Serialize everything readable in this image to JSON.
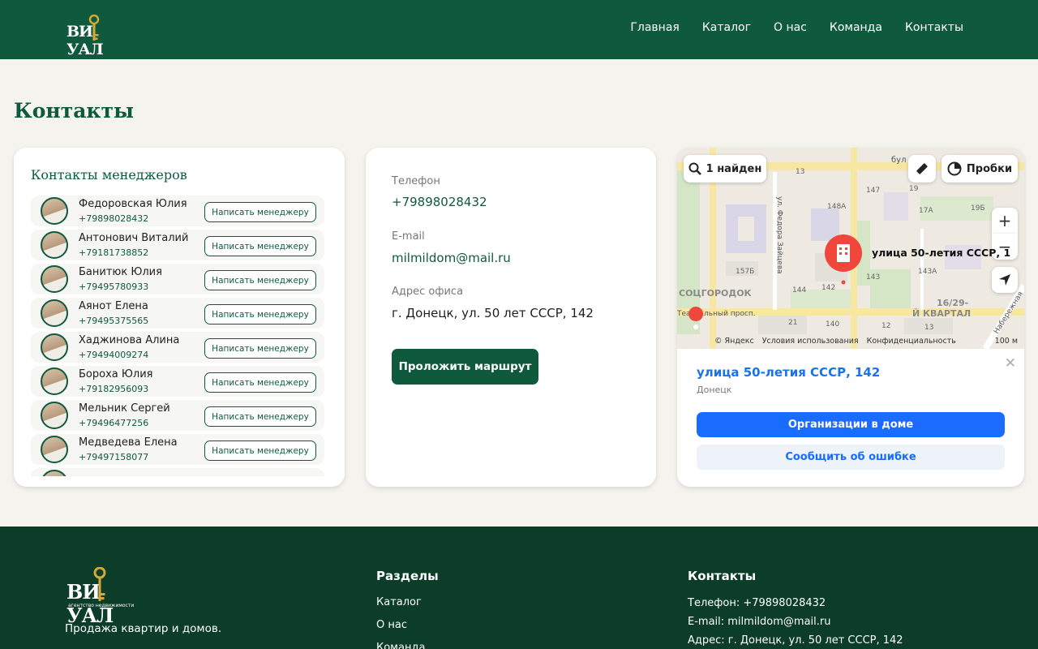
{
  "header": {
    "logo_text": "ВИ УАЛ",
    "nav": [
      "Главная",
      "Каталог",
      "О нас",
      "Команда",
      "Контакты"
    ]
  },
  "page_title": "Контакты",
  "managers": {
    "title": "Контакты менеджеров",
    "button_label": "Написать менеджеру",
    "items": [
      {
        "name": "Федоровская Юлия",
        "phone": "+79898028432"
      },
      {
        "name": "Антонович Виталий",
        "phone": "+79181738852"
      },
      {
        "name": "Банитюк Юлия",
        "phone": "+79495780933"
      },
      {
        "name": "Аянот Елена",
        "phone": "+79495375565"
      },
      {
        "name": "Хаджинова Алина",
        "phone": "+79494009274"
      },
      {
        "name": "Бороха Юлия",
        "phone": "+79182956093"
      },
      {
        "name": "Мельник Сергей",
        "phone": "+79496477256"
      },
      {
        "name": "Медведева Елена",
        "phone": "+79497158077"
      }
    ]
  },
  "contacts": {
    "phone_label": "Телефон",
    "phone": "+79898028432",
    "email_label": "E-mail",
    "email": "milmildom@mail.ru",
    "address_label": "Адрес офиса",
    "address": "г. Донецк, ул. 50 лет СССР, 142",
    "route_button": "Проложить маршрут"
  },
  "map": {
    "search_result": "1 найден",
    "traffic": "Пробки",
    "zoom_in": "+",
    "zoom_out": "−",
    "pin_label": "улица 50-летия СССР, 1",
    "street_label": "ул. Федора Зайцева",
    "district_1": "СОЦГОРОДОК",
    "district_2": "16/29-",
    "district_3": "Й КВАРТАЛ",
    "street_2": "Театральный просп.",
    "street_3": "Набережная",
    "street_4": "бул",
    "footer": [
      "© Яндекс",
      "Условия использования",
      "Конфиденциальность"
    ],
    "scale": "100 м",
    "card_title": "улица 50-летия СССР, 142",
    "card_city": "Донецк",
    "btn_orgs": "Организации в доме",
    "btn_report": "Сообщить об ошибке",
    "house_numbers": [
      "13",
      "147",
      "148А",
      "19",
      "17А",
      "19Б",
      "157Б",
      "144",
      "142",
      "143",
      "143А",
      "21",
      "140",
      "12",
      "13"
    ]
  },
  "footer": {
    "logo_text": "ВИ УАЛ",
    "logo_sub": "агентство недвижимости",
    "tagline": "Продажа квартир и домов.",
    "sections_title": "Разделы",
    "sections": [
      "Каталог",
      "О нас",
      "Команда"
    ],
    "contacts_title": "Контакты",
    "contacts": [
      "Телефон: +79898028432",
      "E-mail: milmildom@mail.ru",
      "Адрес: г. Донецк, ул. 50 лет СССР, 142"
    ]
  },
  "colors": {
    "brand_green": "#0f5a3d",
    "footer_green": "#0b3d28",
    "background": "#f5f3ee",
    "map_blue": "#1a6bff",
    "pin_red": "#f0463c"
  }
}
